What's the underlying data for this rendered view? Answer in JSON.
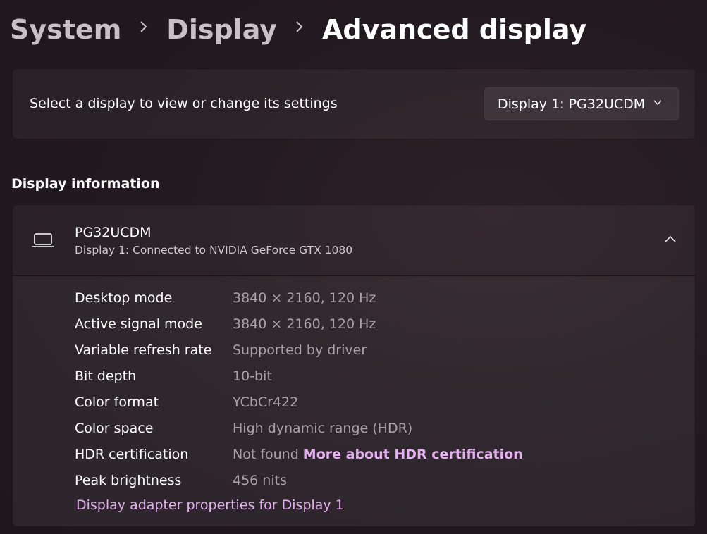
{
  "breadcrumb": {
    "items": [
      "System",
      "Display"
    ],
    "current": "Advanced display"
  },
  "select_display": {
    "label": "Select a display to view or change its settings",
    "dropdown_value": "Display 1: PG32UCDM"
  },
  "display_information": {
    "section_title": "Display information",
    "monitor_name": "PG32UCDM",
    "monitor_subtitle": "Display 1: Connected to NVIDIA GeForce GTX 1080",
    "rows": [
      {
        "label": "Desktop mode",
        "value": "3840 × 2160, 120 Hz"
      },
      {
        "label": "Active signal mode",
        "value": "3840 × 2160, 120 Hz"
      },
      {
        "label": "Variable refresh rate",
        "value": "Supported by driver"
      },
      {
        "label": "Bit depth",
        "value": "10-bit"
      },
      {
        "label": "Color format",
        "value": "YCbCr422"
      },
      {
        "label": "Color space",
        "value": "High dynamic range (HDR)"
      },
      {
        "label": "HDR certification",
        "value": "Not found",
        "link": "More about HDR certification"
      },
      {
        "label": "Peak brightness",
        "value": "456 nits"
      }
    ],
    "adapter_link": "Display adapter properties for Display 1"
  },
  "colors": {
    "accent_link": "#e4b0ef",
    "secondary_text": "#a9a2a7"
  },
  "icons": {
    "breadcrumb_separator": "chevron-right-icon",
    "dropdown": "chevron-down-icon",
    "monitor": "laptop-icon",
    "expander": "chevron-up-icon"
  }
}
